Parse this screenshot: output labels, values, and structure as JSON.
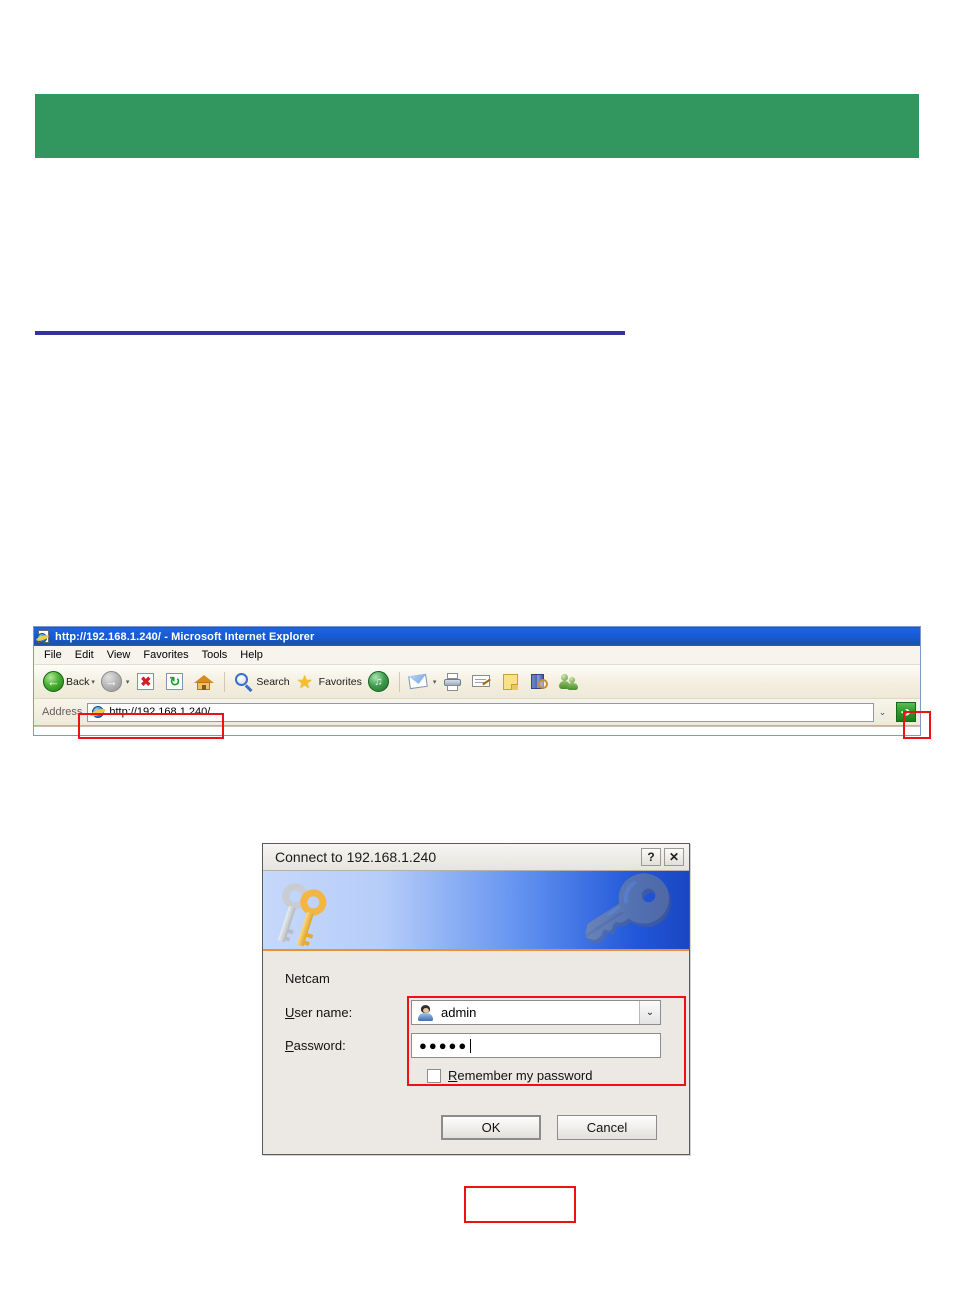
{
  "document": {
    "green_banner_color": "#31975f",
    "blue_rule_color": "#333399"
  },
  "browser": {
    "title": "http://192.168.1.240/ - Microsoft Internet Explorer",
    "window_icon": "ie-document-icon",
    "menu": [
      {
        "label": "File"
      },
      {
        "label": "Edit"
      },
      {
        "label": "View"
      },
      {
        "label": "Favorites"
      },
      {
        "label": "Tools"
      },
      {
        "label": "Help"
      }
    ],
    "toolbar": {
      "back_label": "Back",
      "back_icon": "back-arrow-icon",
      "forward_icon": "forward-arrow-icon",
      "stop_icon": "stop-icon",
      "stop_glyph": "✖",
      "refresh_icon": "refresh-icon",
      "refresh_glyph": "↻",
      "home_icon": "home-icon",
      "search_label": "Search",
      "search_icon": "search-icon",
      "favorites_label": "Favorites",
      "favorites_icon": "star-icon",
      "favorites_glyph": "★",
      "media_icon": "media-icon",
      "media_glyph": "♫",
      "mail_icon": "mail-icon",
      "print_icon": "print-icon",
      "edit_icon": "edit-icon",
      "notes_icon": "notes-icon",
      "research_icon": "research-icon",
      "messenger_icon": "messenger-icon",
      "caret_glyph": "▾"
    },
    "address": {
      "label": "Address",
      "value": "http://192.168.1.240/",
      "placeholder": "http://",
      "site_icon": "ie-globe-icon",
      "dropdown_glyph": "⌄",
      "go_label": "Go",
      "go_glyph": "➔"
    },
    "highlight_color": "#ee1111"
  },
  "auth_dialog": {
    "title": "Connect to 192.168.1.240",
    "help_button_glyph": "?",
    "close_button_glyph": "✕",
    "banner_icon": "keys-icon",
    "realm": "Netcam",
    "username": {
      "label": "User name:",
      "label_accel": "U",
      "label_rest": "ser name:",
      "value": "admin",
      "icon": "user-account-icon",
      "dropdown_glyph": "⌄"
    },
    "password": {
      "label": "Password:",
      "label_accel": "P",
      "label_rest": "assword:",
      "masked_value": "●●●●●",
      "character_count": 5
    },
    "remember": {
      "label": "Remember my password",
      "label_accel": "R",
      "label_rest": "emember my password",
      "checked": false
    },
    "buttons": {
      "ok": "OK",
      "cancel": "Cancel"
    }
  }
}
